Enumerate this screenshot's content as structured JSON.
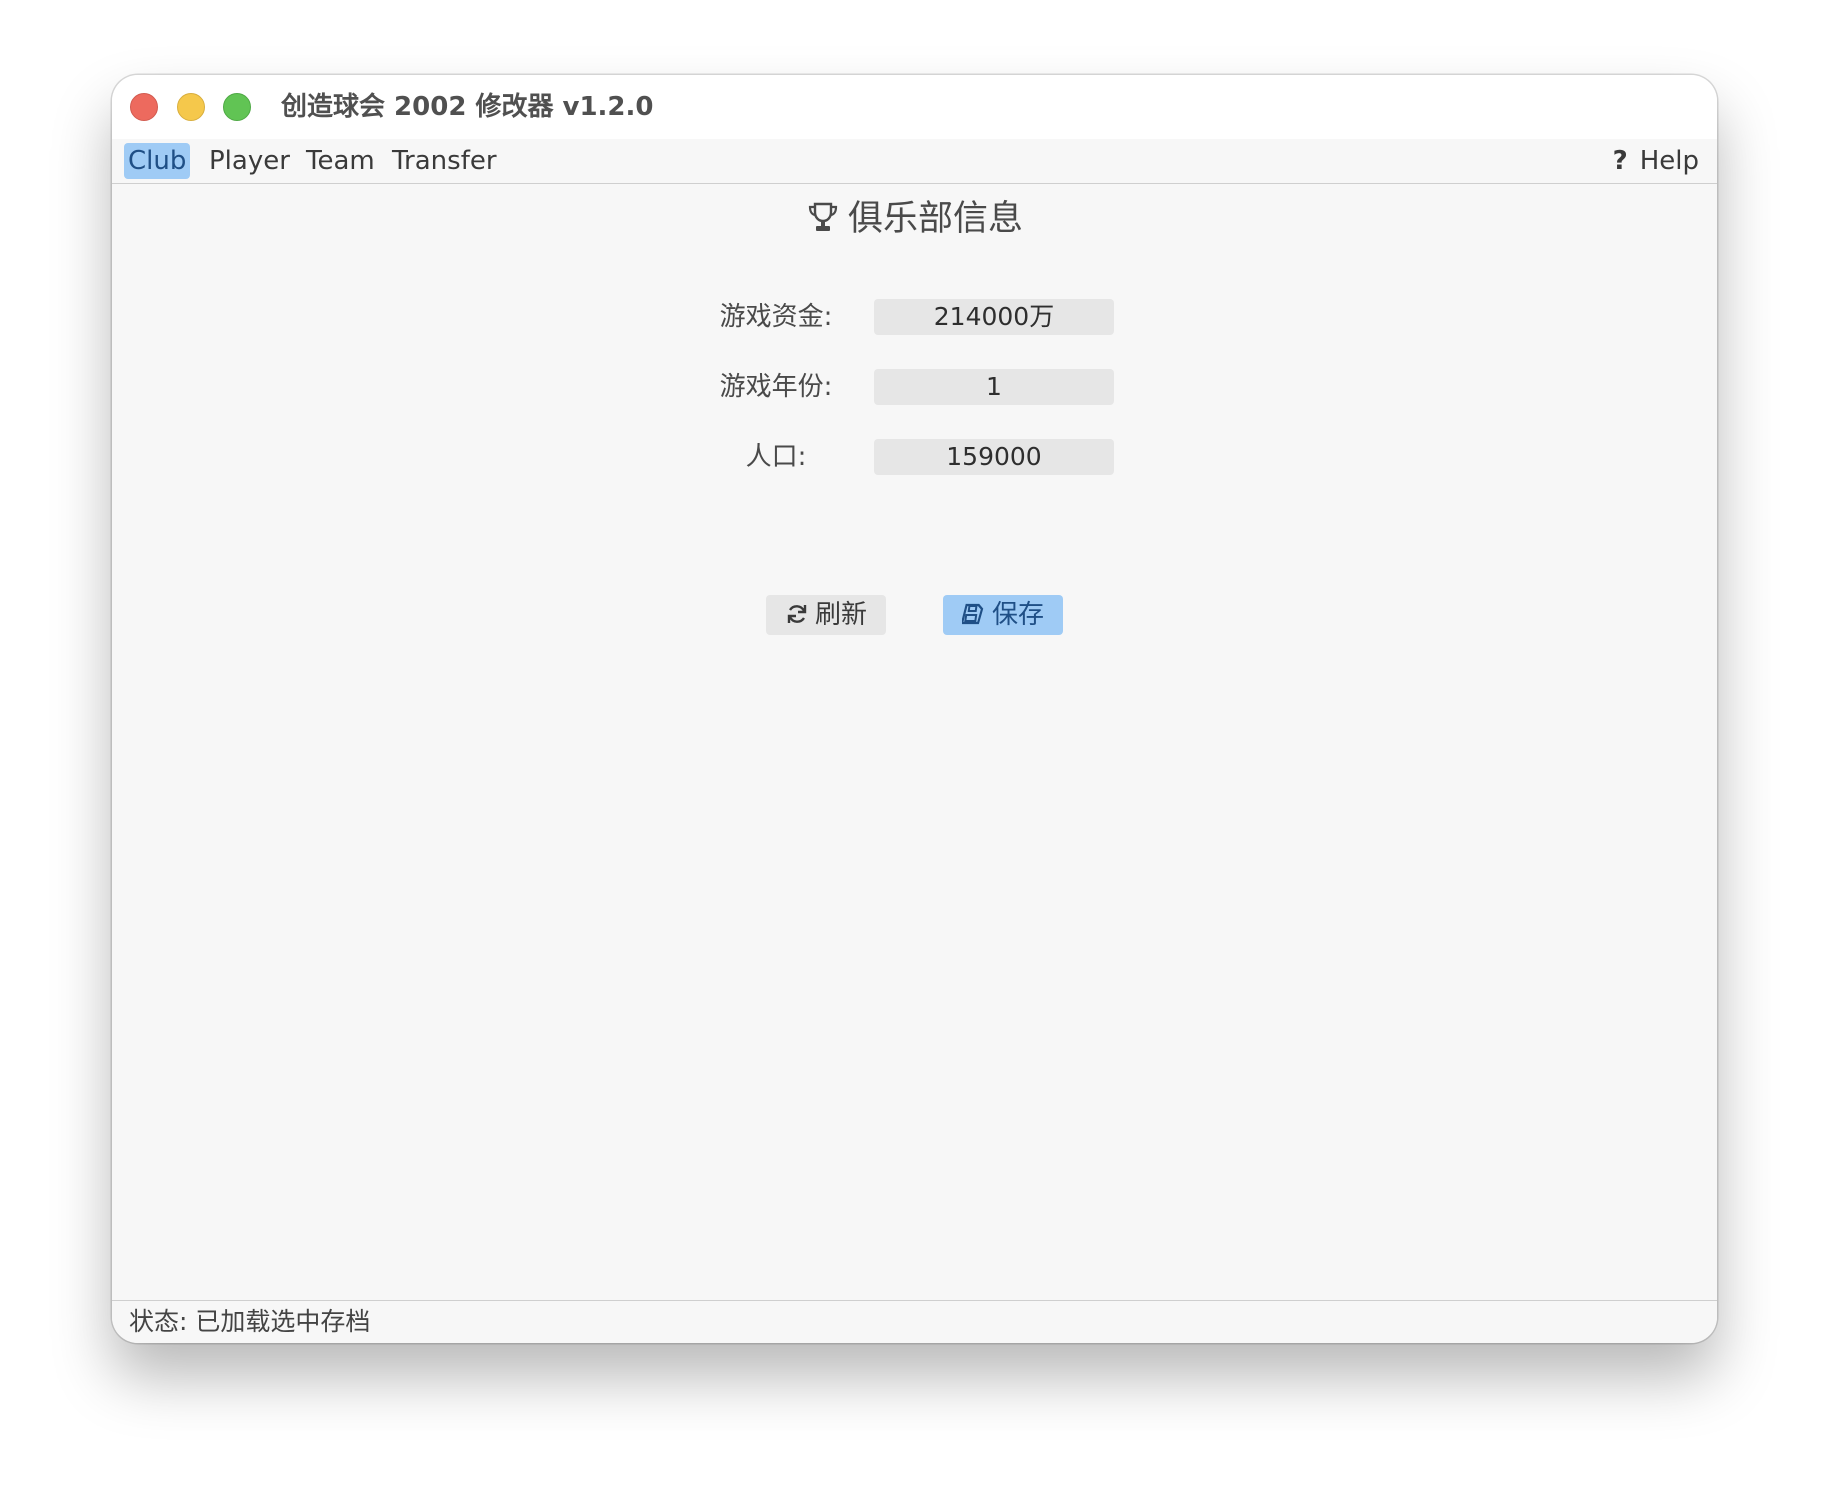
{
  "window": {
    "title": "创造球会 2002 修改器 v1.2.0"
  },
  "menu": {
    "items": [
      {
        "label": "Club",
        "active": true
      },
      {
        "label": "Player",
        "active": false
      },
      {
        "label": "Team",
        "active": false
      },
      {
        "label": "Transfer",
        "active": false
      }
    ],
    "help_icon": "?",
    "help_label": "Help"
  },
  "panel": {
    "title_icon": "trophy-icon",
    "title": "俱乐部信息",
    "fields": [
      {
        "label": "游戏资金:",
        "value": "214000万"
      },
      {
        "label": "游戏年份:",
        "value": "1"
      },
      {
        "label": "人口:",
        "value": "159000"
      }
    ],
    "buttons": {
      "refresh_icon": "refresh-icon",
      "refresh_label": "刷新",
      "save_icon": "save-icon",
      "save_label": "保存"
    }
  },
  "status": {
    "text": "状态:  已加载选中存档"
  },
  "colors": {
    "accent": "#9fcbf5",
    "close": "#ed6a5e",
    "minimize": "#f5c84b",
    "maximize": "#61c454"
  }
}
